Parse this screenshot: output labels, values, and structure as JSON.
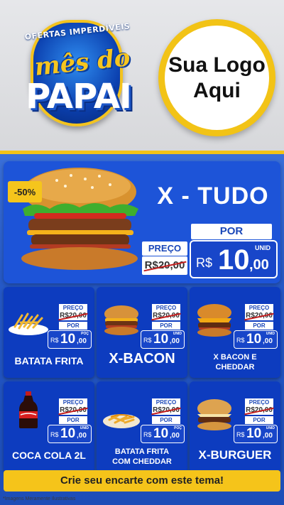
{
  "header": {
    "badge_top": "OFERTAS IMPERDÍVEIS",
    "badge_mes": "mês do",
    "badge_papai": "PAPAI",
    "logo_line1": "Sua Logo",
    "logo_line2": "Aqui"
  },
  "hero": {
    "discount": "-50%",
    "title": "X - TUDO",
    "preco_label": "PREÇO",
    "old_price": "R$20,00",
    "por_label": "POR",
    "currency": "R$",
    "price_int": "10",
    "price_dec": ",00",
    "unid": "UNID"
  },
  "products": [
    {
      "name": "BATATA FRITA",
      "preco_label": "PREÇO",
      "old_price": "R$20,00",
      "por_label": "POR",
      "currency": "R$",
      "price_int": "10",
      "price_dec": ",00",
      "unid": "POÇ"
    },
    {
      "name": "X-BACON",
      "preco_label": "PREÇO",
      "old_price": "R$20,00",
      "por_label": "POR",
      "currency": "R$",
      "price_int": "10",
      "price_dec": ",00",
      "unid": "UNID"
    },
    {
      "name_line1": "X BACON E",
      "name_line2": "CHEDDAR",
      "preco_label": "PREÇO",
      "old_price": "R$20,00",
      "por_label": "POR",
      "currency": "R$",
      "price_int": "10",
      "price_dec": ",00",
      "unid": "UNID"
    },
    {
      "name": "COCA COLA 2L",
      "preco_label": "PREÇO",
      "old_price": "R$20,00",
      "por_label": "POR",
      "currency": "R$",
      "price_int": "10",
      "price_dec": ",00",
      "unid": "UNID"
    },
    {
      "name_line1": "BATATA FRITA",
      "name_line2": "COM CHEDDAR",
      "preco_label": "PREÇO",
      "old_price": "R$20,00",
      "por_label": "POR",
      "currency": "R$",
      "price_int": "10",
      "price_dec": ",00",
      "unid": "POÇ"
    },
    {
      "name": "X-BURGUER",
      "preco_label": "PREÇO",
      "old_price": "R$20,00",
      "por_label": "POR",
      "currency": "R$",
      "price_int": "10",
      "price_dec": ",00",
      "unid": "UNID"
    }
  ],
  "footer": {
    "cta": "Crie seu encarte com este tema!",
    "disclaimer": "*Imagens Meramente Ilustrativas"
  },
  "colors": {
    "brand_blue": "#1d54d8",
    "accent_yellow": "#f5c41a"
  }
}
